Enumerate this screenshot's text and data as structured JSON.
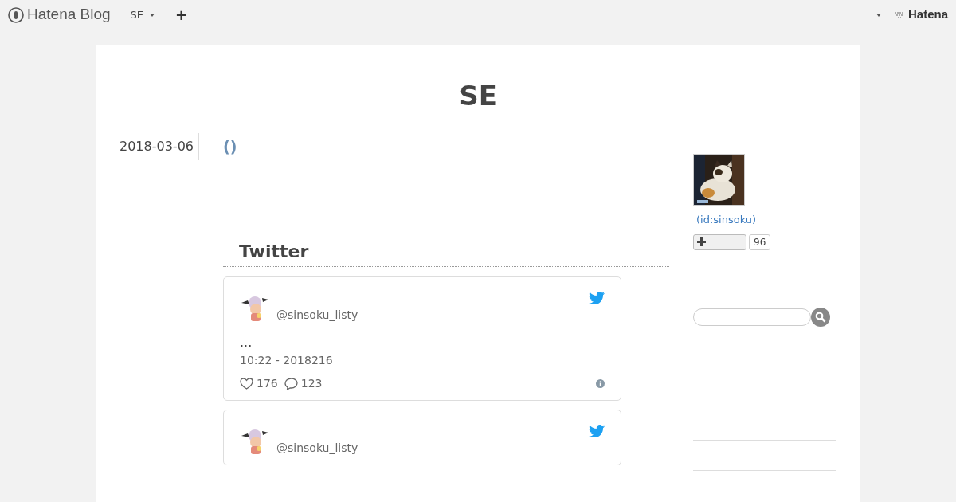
{
  "header": {
    "logo": "Hatena Blog",
    "blog_menu": "SE",
    "add": "+",
    "brand": "Hatena"
  },
  "blog_title": "SE",
  "entry": {
    "date": "2018-03-06",
    "title": "()",
    "section_heading": "Twitter",
    "tweets": [
      {
        "handle": "@sinsoku_listy",
        "text": "...",
        "time": "10:22 - 2018216",
        "likes": "176",
        "replies": "123"
      },
      {
        "handle": "@sinsoku_listy"
      }
    ]
  },
  "sidebar": {
    "profile_id": "(id:sinsoku)",
    "subscribe_count": "96"
  }
}
